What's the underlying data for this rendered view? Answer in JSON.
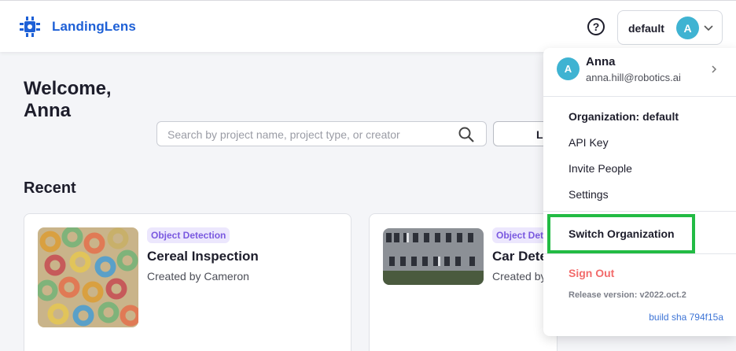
{
  "header": {
    "brand": "LandingLens",
    "help_glyph": "?",
    "org_name": "default",
    "avatar_initial": "A"
  },
  "main": {
    "welcome": "Welcome, Anna",
    "search_placeholder": "Search by project name, project type, or creator",
    "side_button_label": "L",
    "recent_heading": "Recent"
  },
  "cards": [
    {
      "badge": "Object Detection",
      "title": "Cereal Inspection",
      "subtitle": "Created by Cameron"
    },
    {
      "badge": "Object Det",
      "title": "Car Dete",
      "subtitle": "Created by"
    }
  ],
  "menu": {
    "user_initial": "A",
    "user_name": "Anna",
    "user_email": "anna.hill@robotics.ai",
    "organization": "Organization: default",
    "api_key": "API Key",
    "invite": "Invite People",
    "settings": "Settings",
    "switch_org": "Switch Organization",
    "sign_out": "Sign Out",
    "release": "Release version: v2022.oct.2",
    "build_sha": "build sha 794f15a"
  },
  "colors": {
    "brand": "#1e60d6",
    "avatar": "#3fb3d2",
    "badge_bg": "#ece7fd",
    "badge_text": "#7a59e0",
    "highlight": "#22bb44",
    "sign_out": "#f26b6b"
  },
  "icons": [
    "logo-icon",
    "help-icon",
    "chevron-down-icon",
    "search-icon",
    "chevron-right-icon"
  ]
}
